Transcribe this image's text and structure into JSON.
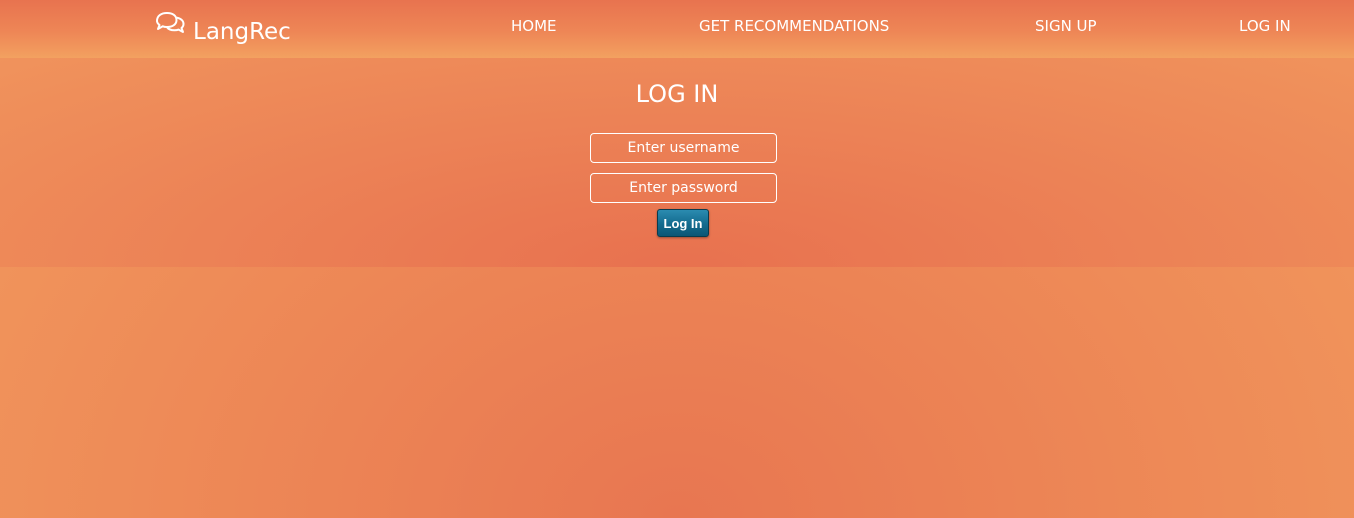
{
  "brand": {
    "name": "LangRec",
    "icon": "chat-bubbles-icon"
  },
  "nav": {
    "home": "HOME",
    "recommendations": "GET RECOMMENDATIONS",
    "signup": "SIGN UP",
    "login": "LOG IN"
  },
  "login_form": {
    "title": "LOG IN",
    "username_placeholder": "Enter username",
    "username_value": "",
    "password_placeholder": "Enter password",
    "password_value": "",
    "submit_label": "Log In"
  },
  "colors": {
    "gradient_light": "#f29b5e",
    "gradient_dark": "#e8714f",
    "button": "#136b8e",
    "text": "#ffffff"
  }
}
